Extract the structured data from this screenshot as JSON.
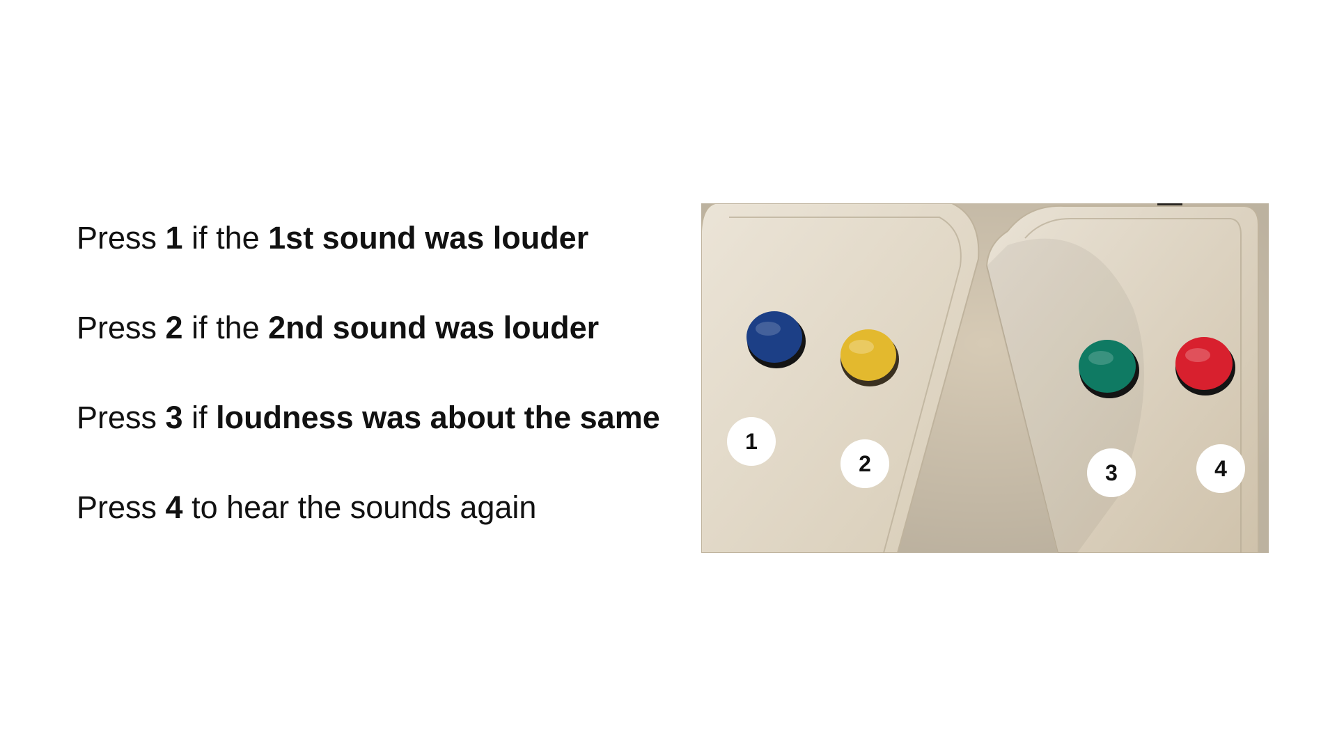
{
  "instructions": [
    {
      "prefix": "Press ",
      "key": "1",
      "middle": " if the ",
      "emphasis": "1st sound was louder",
      "suffix": ""
    },
    {
      "prefix": "Press ",
      "key": "2",
      "middle": " if the ",
      "emphasis": "2nd sound was louder",
      "suffix": ""
    },
    {
      "prefix": "Press ",
      "key": "3",
      "middle": " if ",
      "emphasis": "loudness was about the same",
      "suffix": ""
    },
    {
      "prefix": "Press ",
      "key": "4",
      "middle": " to hear the sounds again",
      "emphasis": "",
      "suffix": ""
    }
  ],
  "photo": {
    "buttons": [
      {
        "label": "1",
        "color": "#1c3f86"
      },
      {
        "label": "2",
        "color": "#e3b92e"
      },
      {
        "label": "3",
        "color": "#0f7a63"
      },
      {
        "label": "4",
        "color": "#d8202e"
      }
    ]
  }
}
